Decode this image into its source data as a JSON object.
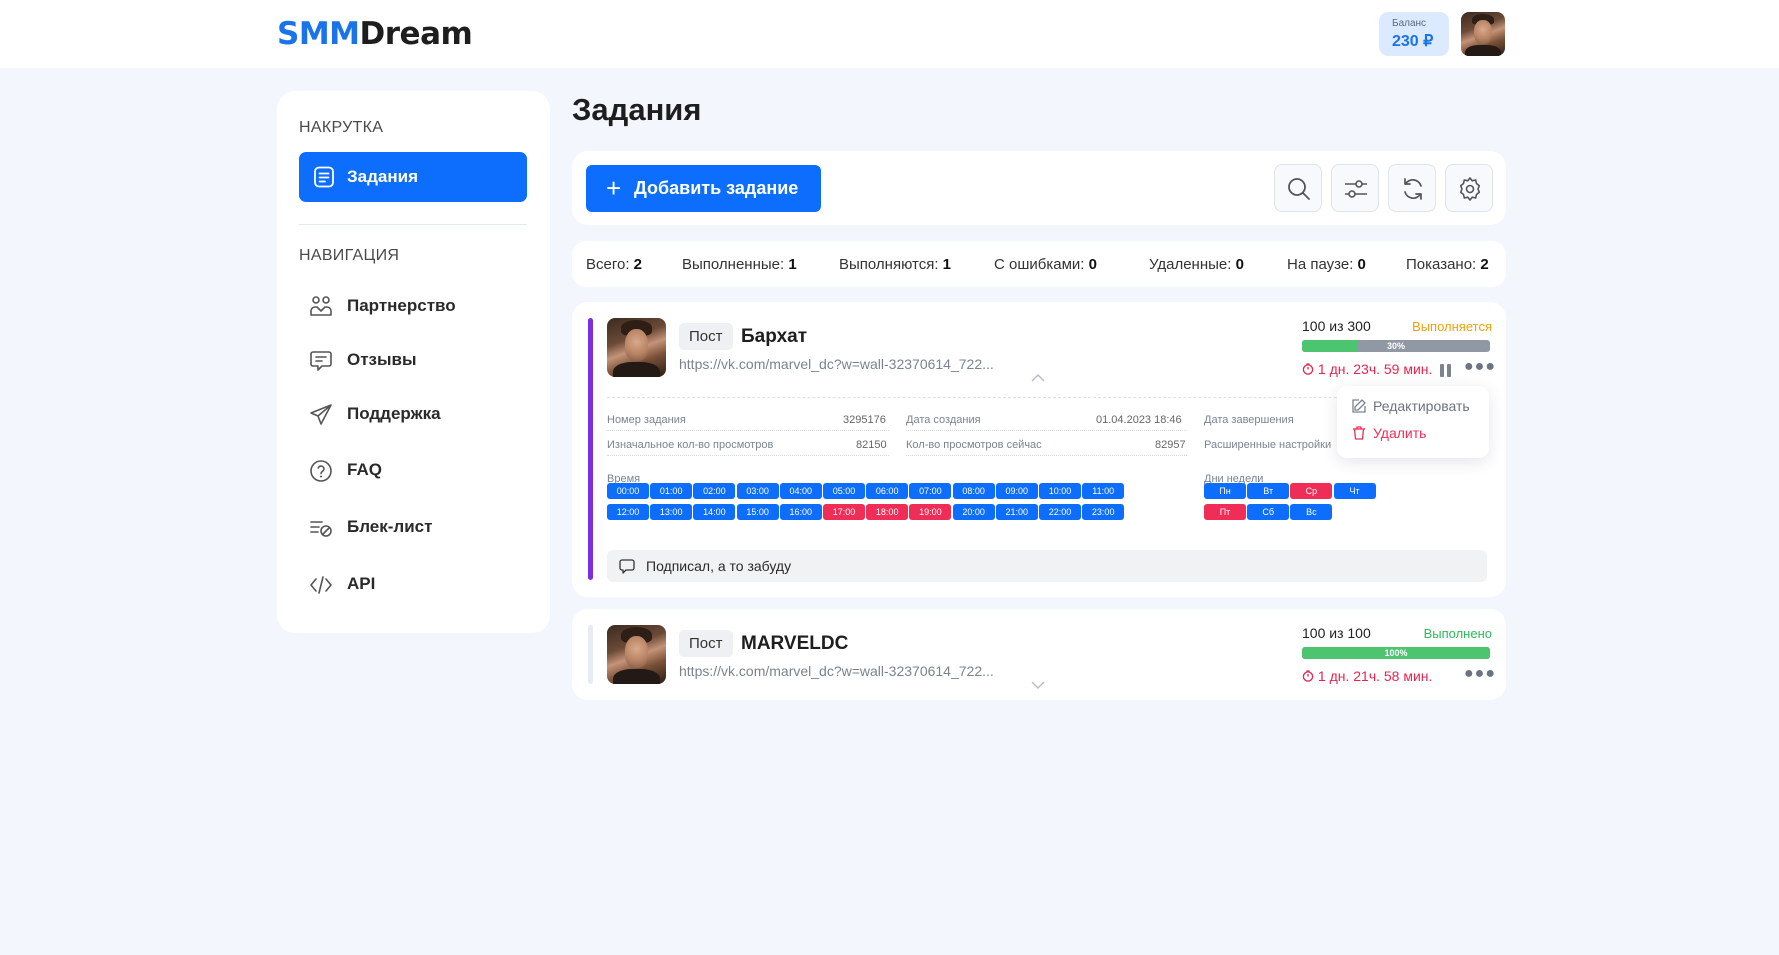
{
  "header": {
    "logo_part1": "SMM",
    "logo_part2": "Dream",
    "balance_label": "Баланс",
    "balance_value": "230 ₽"
  },
  "sidebar": {
    "section1": "НАКРУТКА",
    "active_item": "Задания",
    "section2": "НАВИГАЦИЯ",
    "items": [
      {
        "label": "Партнерство",
        "icon": "partnership-icon"
      },
      {
        "label": "Отзывы",
        "icon": "reviews-icon"
      },
      {
        "label": "Поддержка",
        "icon": "support-icon"
      },
      {
        "label": "FAQ",
        "icon": "faq-icon"
      },
      {
        "label": "Блек-лист",
        "icon": "blacklist-icon"
      },
      {
        "label": "API",
        "icon": "api-icon"
      }
    ]
  },
  "page": {
    "title": "Задания"
  },
  "toolbar": {
    "add_label": "Добавить задание",
    "tools": [
      "search-icon",
      "filters-icon",
      "refresh-icon",
      "settings-icon"
    ]
  },
  "stats": [
    {
      "label": "Всего:",
      "value": "2"
    },
    {
      "label": "Выполненные:",
      "value": "1"
    },
    {
      "label": "Выполняются:",
      "value": "1"
    },
    {
      "label": "С ошибками:",
      "value": "0"
    },
    {
      "label": "Удаленные:",
      "value": "0"
    },
    {
      "label": "На паузе:",
      "value": "0"
    },
    {
      "label": "Показано:",
      "value": "2"
    }
  ],
  "tasks": [
    {
      "tag": "Пост",
      "title": "Бархат",
      "link": "https://vk.com/marvel_dc?w=wall-32370614_722...",
      "count": "100 из 300",
      "status": "Выполняется",
      "status_color": "#f0a10a",
      "progress": 0.3,
      "progress_label": "30%",
      "timer": "1 дн. 23ч. 59 мин.",
      "accent": "#7b2fe0",
      "details": {
        "task_number_label": "Номер задания",
        "task_number": "3295176",
        "created_label": "Дата создания",
        "created": "01.04.2023 18:46",
        "finished_label": "Дата завершения",
        "initial_views_label": "Изначальное кол-во просмотров",
        "initial_views": "82150",
        "current_views_label": "Кол-во просмотров сейчас",
        "current_views": "82957",
        "advanced_label": "Расширенные настройки",
        "time_label": "Время",
        "days_label": "Дни недели",
        "hours": [
          {
            "t": "00:00",
            "on": true
          },
          {
            "t": "01:00",
            "on": true
          },
          {
            "t": "02:00",
            "on": true
          },
          {
            "t": "03:00",
            "on": true
          },
          {
            "t": "04:00",
            "on": true
          },
          {
            "t": "05:00",
            "on": true
          },
          {
            "t": "06:00",
            "on": true
          },
          {
            "t": "07:00",
            "on": true
          },
          {
            "t": "08:00",
            "on": true
          },
          {
            "t": "09:00",
            "on": true
          },
          {
            "t": "10:00",
            "on": true
          },
          {
            "t": "11:00",
            "on": true
          },
          {
            "t": "12:00",
            "on": true
          },
          {
            "t": "13:00",
            "on": true
          },
          {
            "t": "14:00",
            "on": true
          },
          {
            "t": "15:00",
            "on": true
          },
          {
            "t": "16:00",
            "on": true
          },
          {
            "t": "17:00",
            "on": false
          },
          {
            "t": "18:00",
            "on": false
          },
          {
            "t": "19:00",
            "on": false
          },
          {
            "t": "20:00",
            "on": true
          },
          {
            "t": "21:00",
            "on": true
          },
          {
            "t": "22:00",
            "on": true
          },
          {
            "t": "23:00",
            "on": true
          }
        ],
        "days": [
          {
            "d": "Пн",
            "on": true
          },
          {
            "d": "Вт",
            "on": true
          },
          {
            "d": "Ср",
            "on": false
          },
          {
            "d": "Чт",
            "on": true
          },
          {
            "d": "Пт",
            "on": false
          },
          {
            "d": "Сб",
            "on": true
          },
          {
            "d": "Вс",
            "on": true
          }
        ],
        "comment": "Подписал, а то забуду"
      },
      "menu": {
        "edit": "Редактировать",
        "delete": "Удалить"
      }
    },
    {
      "tag": "Пост",
      "title": "MARVELDC",
      "link": "https://vk.com/marvel_dc?w=wall-32370614_722...",
      "count": "100 из 100",
      "status": "Выполнено",
      "status_color": "#2dbb5a",
      "progress": 1.0,
      "progress_label": "100%",
      "timer": "1 дн. 21ч. 58 мин.",
      "accent": "#e8ebef"
    }
  ],
  "colors": {
    "primary": "#0d6efd",
    "danger": "#ef2d56",
    "progress": "#4cc470"
  }
}
